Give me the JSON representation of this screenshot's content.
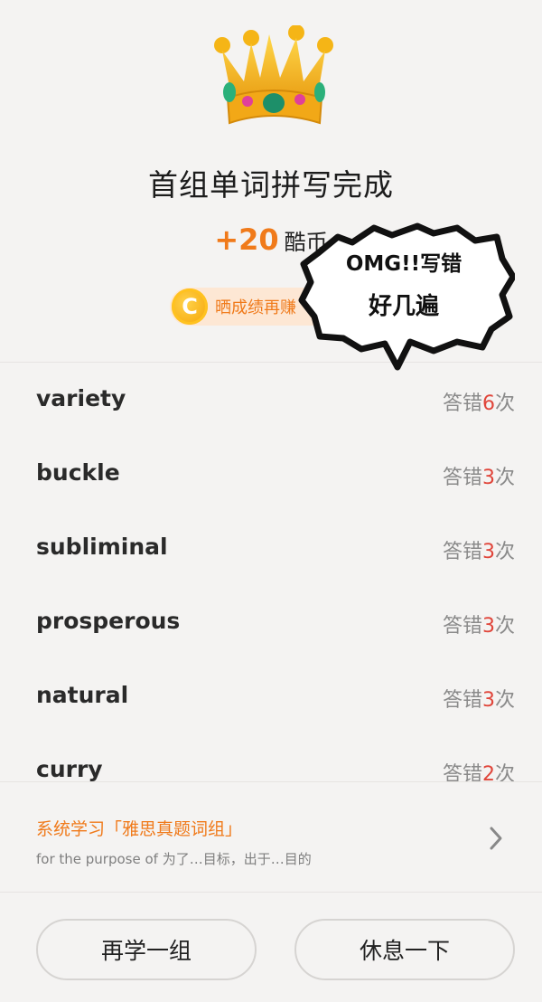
{
  "header": {
    "title": "首组单词拼写完成",
    "reward_amount": "+20",
    "reward_unit": "酷币",
    "share_label": "晒成绩再赚",
    "coin_symbol": "C"
  },
  "sticker": {
    "line1": "OMG!!写错",
    "line2": "好几遍"
  },
  "words": [
    {
      "word": "variety",
      "prefix": "答错",
      "count": "6",
      "suffix": "次"
    },
    {
      "word": "buckle",
      "prefix": "答错",
      "count": "3",
      "suffix": "次"
    },
    {
      "word": "subliminal",
      "prefix": "答错",
      "count": "3",
      "suffix": "次"
    },
    {
      "word": "prosperous",
      "prefix": "答错",
      "count": "3",
      "suffix": "次"
    },
    {
      "word": "natural",
      "prefix": "答错",
      "count": "3",
      "suffix": "次"
    },
    {
      "word": "curry",
      "prefix": "答错",
      "count": "2",
      "suffix": "次"
    }
  ],
  "study": {
    "title": "系统学习「雅思真题词组」",
    "subtitle": "for the purpose of 为了…目标，出于…目的"
  },
  "buttons": {
    "again": "再学一组",
    "rest": "休息一下"
  },
  "colors": {
    "accent": "#f07a1a",
    "error": "#e0453a"
  }
}
